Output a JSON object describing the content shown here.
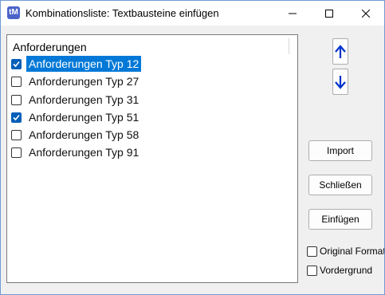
{
  "window": {
    "title": "Kombinationsliste: Textbausteine einfügen",
    "icon_text": "tM",
    "accent_color": "#0078d7"
  },
  "list": {
    "header": "Anforderungen",
    "items": [
      {
        "label": "Anforderungen Typ 12",
        "checked": true,
        "selected": true
      },
      {
        "label": "Anforderungen Typ 27",
        "checked": false,
        "selected": false
      },
      {
        "label": "Anforderungen Typ 31",
        "checked": false,
        "selected": false
      },
      {
        "label": "Anforderungen Typ 51",
        "checked": true,
        "selected": false
      },
      {
        "label": "Anforderungen Typ 58",
        "checked": false,
        "selected": false
      },
      {
        "label": "Anforderungen Typ 91",
        "checked": false,
        "selected": false
      }
    ]
  },
  "buttons": {
    "import": "Import",
    "close": "Schließen",
    "insert": "Einfügen"
  },
  "options": {
    "original_format": {
      "label": "Original Format",
      "checked": false
    },
    "foreground": {
      "label": "Vordergrund",
      "checked": false
    }
  }
}
